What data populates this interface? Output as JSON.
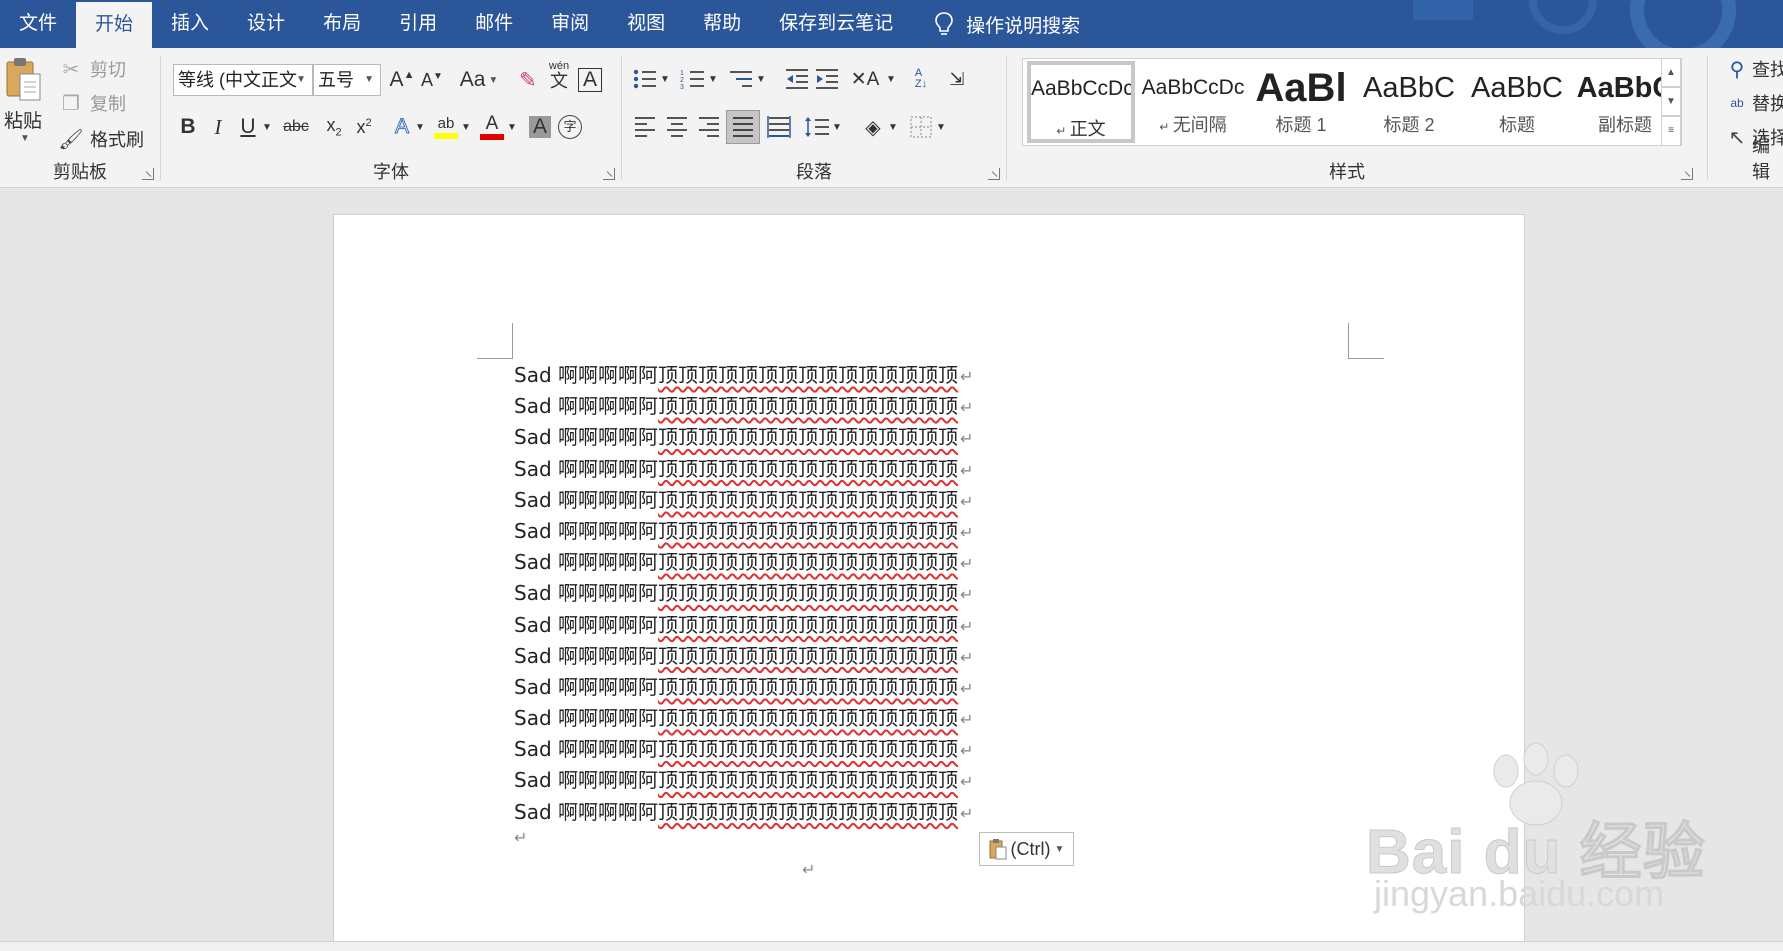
{
  "tabs": [
    {
      "label": "文件",
      "active": false
    },
    {
      "label": "开始",
      "active": true
    },
    {
      "label": "插入",
      "active": false
    },
    {
      "label": "设计",
      "active": false
    },
    {
      "label": "布局",
      "active": false
    },
    {
      "label": "引用",
      "active": false
    },
    {
      "label": "邮件",
      "active": false
    },
    {
      "label": "审阅",
      "active": false
    },
    {
      "label": "视图",
      "active": false
    },
    {
      "label": "帮助",
      "active": false
    },
    {
      "label": "保存到云笔记",
      "active": false
    }
  ],
  "tell_me": {
    "label": "操作说明搜索",
    "icon": "lightbulb-icon"
  },
  "clipboard": {
    "group_label": "剪贴板",
    "paste": "粘贴",
    "cut": "剪切",
    "copy": "复制",
    "format_painter": "格式刷"
  },
  "font": {
    "group_label": "字体",
    "font_name": "等线 (中文正文",
    "font_size": "五号",
    "change_case": "Aa",
    "phonetic_top": "wén",
    "phonetic_bottom": "文"
  },
  "paragraph": {
    "group_label": "段落"
  },
  "styles": {
    "group_label": "样式",
    "items": [
      {
        "sample": "AaBbCcDc",
        "name": "正文",
        "selected": true
      },
      {
        "sample": "AaBbCcDc",
        "name": "无间隔",
        "selected": false
      },
      {
        "sample": "AaBl",
        "name": "标题 1",
        "selected": false
      },
      {
        "sample": "AaBbC",
        "name": "标题 2",
        "selected": false
      },
      {
        "sample": "AaBbC",
        "name": "标题",
        "selected": false
      },
      {
        "sample": "AaBbC",
        "name": "副标题",
        "selected": false
      }
    ]
  },
  "editing": {
    "group_label": "编辑",
    "find": "查找",
    "replace": "替换",
    "select": "选择"
  },
  "document": {
    "line_prefix": "Sad 啊啊啊啊阿",
    "line_suffix": "顶顶顶顶顶顶顶顶顶顶顶顶顶顶顶",
    "line_count": 15,
    "paragraph_mark": "↵"
  },
  "paste_options": {
    "label": "(Ctrl)"
  },
  "watermark": {
    "main": "Bai du 经验",
    "sub": "jingyan.baidu.com"
  },
  "colors": {
    "accent": "#2b579a",
    "highlight": "#ffff00",
    "font_color": "#e00000",
    "squiggle": "#e03030"
  }
}
